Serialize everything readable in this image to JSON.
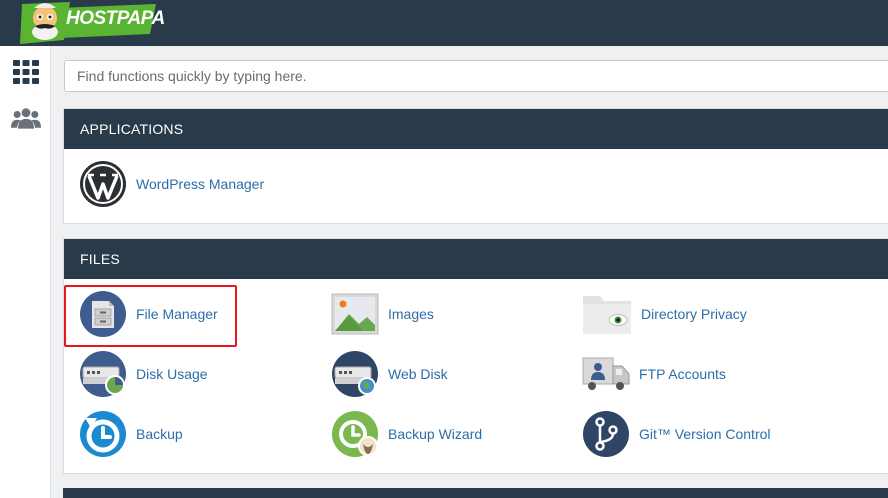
{
  "header": {
    "brand": "HOSTPAPA"
  },
  "search": {
    "placeholder": "Find functions quickly by typing here."
  },
  "sections": {
    "applications": {
      "title": "APPLICATIONS",
      "items": {
        "wordpress": "WordPress Manager"
      }
    },
    "files": {
      "title": "FILES",
      "items": {
        "file_manager": "File Manager",
        "images": "Images",
        "directory_privacy": "Directory Privacy",
        "disk_usage": "Disk Usage",
        "web_disk": "Web Disk",
        "ftp_accounts": "FTP Accounts",
        "backup": "Backup",
        "backup_wizard": "Backup Wizard",
        "git": "Git™ Version Control"
      }
    }
  },
  "colors": {
    "header_bg": "#293a4a",
    "link": "#2c6ea8",
    "highlight": "#e5161d"
  },
  "icons": {
    "sidebar": [
      "grid-icon",
      "users-icon"
    ]
  }
}
